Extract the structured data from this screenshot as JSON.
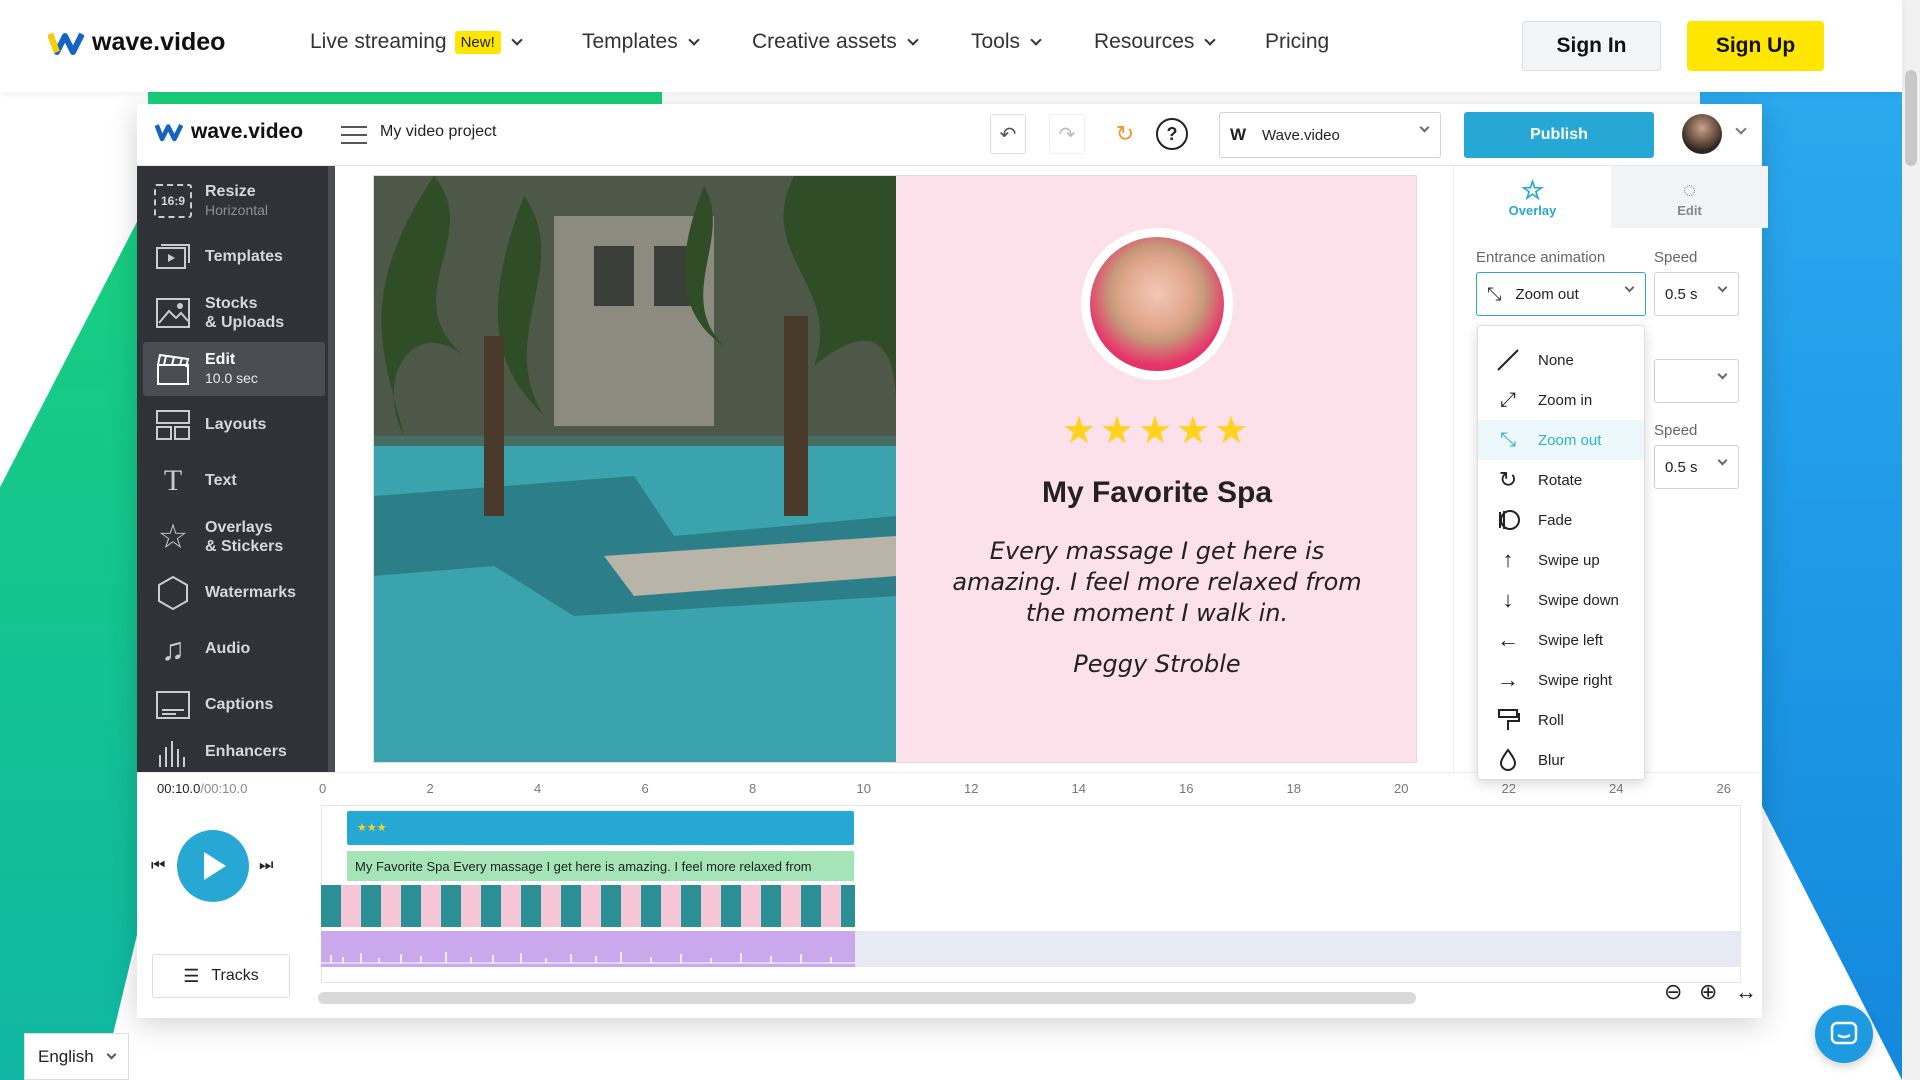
{
  "site_header": {
    "logo_text": "wave.video",
    "nav": [
      {
        "label": "Live streaming",
        "badge": "New!"
      },
      {
        "label": "Templates"
      },
      {
        "label": "Creative assets"
      },
      {
        "label": "Tools"
      },
      {
        "label": "Resources"
      },
      {
        "label": "Pricing"
      }
    ],
    "signin_label": "Sign In",
    "signup_label": "Sign Up"
  },
  "editor": {
    "logo_text": "wave.video",
    "project_name": "My video project",
    "brand_select": {
      "icon_letter": "W",
      "value": "Wave.video"
    },
    "publish_label": "Publish",
    "sidebar": [
      {
        "label": "Resize",
        "sub": "Horizontal",
        "icon": "resize-icon",
        "icon_text": "16:9"
      },
      {
        "label": "Templates",
        "icon": "templates-icon"
      },
      {
        "label": "Stocks",
        "sub": "& Uploads",
        "icon": "image-icon"
      },
      {
        "label": "Edit",
        "sub": "10.0 sec",
        "icon": "clapperboard-icon",
        "active": true
      },
      {
        "label": "Layouts",
        "icon": "layouts-icon"
      },
      {
        "label": "Text",
        "icon": "text-icon",
        "icon_text": "T"
      },
      {
        "label": "Overlays",
        "sub": "& Stickers",
        "icon": "star-icon"
      },
      {
        "label": "Watermarks",
        "icon": "watermark-icon"
      },
      {
        "label": "Audio",
        "icon": "music-icon"
      },
      {
        "label": "Captions",
        "icon": "captions-icon"
      },
      {
        "label": "Enhancers",
        "icon": "enhancers-icon"
      }
    ],
    "canvas": {
      "stars": "★★★★★",
      "title": "My Favorite Spa",
      "quote": "Every massage I get here is amazing. I feel more relaxed from the moment I walk in.",
      "author": "Peggy Stroble"
    },
    "right_panel": {
      "tabs": [
        {
          "label": "Overlay",
          "icon": "star-icon",
          "active": true
        },
        {
          "label": "Edit",
          "icon": "palette-icon"
        }
      ],
      "entrance_label": "Entrance animation",
      "entrance_value": "Zoom out",
      "speed_label": "Speed",
      "speed_value": "0.5 s",
      "speed2_label": "Speed",
      "speed2_value": "0.5 s"
    },
    "animation_menu": [
      {
        "label": "None",
        "icon": "none-icon"
      },
      {
        "label": "Zoom in",
        "icon": "zoom-in-icon"
      },
      {
        "label": "Zoom out",
        "icon": "zoom-out-icon",
        "selected": true
      },
      {
        "label": "Rotate",
        "icon": "rotate-icon"
      },
      {
        "label": "Fade",
        "icon": "fade-icon"
      },
      {
        "label": "Swipe up",
        "icon": "arrow-up-icon"
      },
      {
        "label": "Swipe down",
        "icon": "arrow-down-icon"
      },
      {
        "label": "Swipe left",
        "icon": "arrow-left-icon"
      },
      {
        "label": "Swipe right",
        "icon": "arrow-right-icon"
      },
      {
        "label": "Roll",
        "icon": "roll-icon"
      },
      {
        "label": "Blur",
        "icon": "drop-icon"
      }
    ],
    "timeline": {
      "time_current": "00:10.0",
      "time_total": "/00:10.0",
      "ticks": [
        "0",
        "2",
        "4",
        "6",
        "8",
        "10",
        "12",
        "14",
        "16",
        "18",
        "20",
        "22",
        "24",
        "26"
      ],
      "overlay_clip_label": "★★★",
      "text_clip_label": "My Favorite Spa Every massage I get here is amazing. I feel more relaxed from",
      "tracks_label": "Tracks"
    }
  },
  "language": "English",
  "colors": {
    "accent": "#27a8d4",
    "signup": "#ffe600",
    "sidebar": "#2f3237",
    "canvas_bg": "#fce0ea"
  }
}
